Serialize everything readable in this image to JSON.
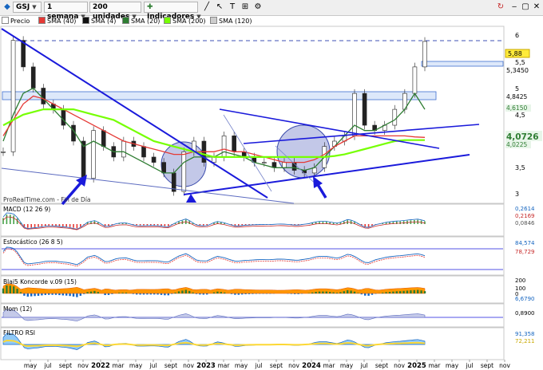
{
  "toolbar": {
    "symbol": "GSJ",
    "timeframe": "1 semana",
    "units": "200 unidades",
    "indicators_label": "Indicadores"
  },
  "price_legend": [
    {
      "label": "Precio",
      "color": "#ffffff"
    },
    {
      "label": "SMA (40)",
      "color": "#e53935"
    },
    {
      "label": "SMA (4)",
      "color": "#111111"
    },
    {
      "label": "SMA (20)",
      "color": "#2e7d32"
    },
    {
      "label": "SMA (200)",
      "color": "#76ff03"
    },
    {
      "label": "SMA (120)",
      "color": "#cccccc"
    }
  ],
  "price_axis": {
    "ticks": [
      "6",
      "5,5",
      "5",
      "4,5",
      "4",
      "3,5",
      "3"
    ],
    "labels": [
      {
        "text": "5,88",
        "style": "yellow"
      },
      {
        "text": "5,3450",
        "style": "plain"
      },
      {
        "text": "4,8425",
        "style": "plain"
      },
      {
        "text": "4,6150",
        "style": "green"
      },
      {
        "text": "4,0726",
        "style": "green-bold"
      },
      {
        "text": "4,0225",
        "style": "green"
      }
    ]
  },
  "watermark": "ProRealTime.com - Fin de Día",
  "panels": [
    {
      "key": "macd",
      "title": "MACD (12 26 9)",
      "values": [
        "0,2614",
        "0,2169",
        "0,0846"
      ]
    },
    {
      "key": "stoch",
      "title": "Estocástico (26 8 5)",
      "values": [
        "84,574",
        "78,729"
      ]
    },
    {
      "key": "konc",
      "title": "Blai5 Koncorde v.09 (15)",
      "values": [
        "200",
        "100",
        "0",
        "6,6790"
      ]
    },
    {
      "key": "mom",
      "title": "Mom (12)",
      "values": [
        "0,8900"
      ]
    },
    {
      "key": "rsi",
      "title": "FILTRO RSI",
      "values": [
        "91,358",
        "72,211"
      ]
    }
  ],
  "x_axis": [
    "may",
    "jul",
    "sept",
    "nov",
    "2022",
    "mar",
    "may",
    "jul",
    "sept",
    "nov",
    "2023",
    "mar",
    "may",
    "jul",
    "sept",
    "nov",
    "2024",
    "mar",
    "may",
    "jul",
    "sept",
    "nov",
    "2025",
    "mar",
    "may",
    "jul",
    "sept",
    "nov"
  ],
  "chart_data": {
    "type": "line",
    "title": "GSJ",
    "ylim": [
      2.9,
      6.2
    ],
    "x": [
      "2021-03",
      "2021-04",
      "2021-05",
      "2021-06",
      "2021-07",
      "2021-08",
      "2021-09",
      "2021-10",
      "2021-11",
      "2021-12",
      "2022-01",
      "2022-02",
      "2022-03",
      "2022-04",
      "2022-05",
      "2022-06",
      "2022-07",
      "2022-08",
      "2022-09",
      "2022-10",
      "2022-11",
      "2022-12",
      "2023-01",
      "2023-02",
      "2023-03",
      "2023-04",
      "2023-05",
      "2023-06",
      "2023-07",
      "2023-08",
      "2023-09",
      "2023-10",
      "2023-11",
      "2023-12",
      "2024-01",
      "2024-02",
      "2024-03",
      "2024-04",
      "2024-05",
      "2024-06",
      "2024-07",
      "2024-08",
      "2024-09",
      "2024-10",
      "2024-11",
      "2024-12",
      "2025-01"
    ],
    "series": [
      {
        "name": "Precio",
        "values": [
          3.8,
          5.9,
          5.4,
          5.0,
          4.7,
          4.6,
          4.3,
          4.0,
          3.3,
          4.2,
          3.9,
          3.7,
          4.0,
          3.9,
          3.7,
          3.6,
          3.4,
          3.05,
          3.8,
          4.0,
          3.6,
          3.7,
          4.1,
          3.8,
          3.7,
          3.6,
          3.6,
          3.5,
          3.6,
          3.45,
          3.4,
          3.5,
          3.9,
          4.0,
          4.1,
          4.9,
          4.3,
          4.2,
          4.3,
          4.6,
          4.9,
          5.4,
          5.88
        ]
      },
      {
        "name": "SMA (20)",
        "values": [
          4.0,
          4.5,
          4.9,
          5.0,
          4.8,
          4.6,
          4.4,
          4.2,
          3.9,
          4.0,
          3.9,
          3.8,
          3.8,
          3.7,
          3.6,
          3.5,
          3.4,
          3.4,
          3.6,
          3.7,
          3.7,
          3.7,
          3.8,
          3.75,
          3.7,
          3.6,
          3.55,
          3.5,
          3.5,
          3.5,
          3.45,
          3.5,
          3.7,
          3.9,
          4.1,
          4.3,
          4.2,
          4.2,
          4.3,
          4.4,
          4.6,
          4.9,
          4.6
        ]
      },
      {
        "name": "SMA (40)",
        "values": [
          4.1,
          4.4,
          4.7,
          4.85,
          4.8,
          4.7,
          4.6,
          4.5,
          4.4,
          4.3,
          4.2,
          4.1,
          4.0,
          3.95,
          3.9,
          3.85,
          3.8,
          3.75,
          3.75,
          3.8,
          3.8,
          3.8,
          3.85,
          3.8,
          3.8,
          3.75,
          3.7,
          3.65,
          3.6,
          3.6,
          3.6,
          3.65,
          3.75,
          3.9,
          4.0,
          4.1,
          4.1,
          4.1,
          4.1,
          4.1,
          4.1,
          4.08,
          4.07
        ]
      },
      {
        "name": "SMA (200)",
        "values": [
          4.3,
          4.4,
          4.5,
          4.55,
          4.6,
          4.6,
          4.6,
          4.6,
          4.55,
          4.5,
          4.45,
          4.4,
          4.3,
          4.2,
          4.1,
          4.0,
          3.95,
          3.9,
          3.85,
          3.8,
          3.75,
          3.7,
          3.7,
          3.7,
          3.7,
          3.7,
          3.7,
          3.7,
          3.7,
          3.7,
          3.7,
          3.7,
          3.7,
          3.72,
          3.75,
          3.8,
          3.85,
          3.9,
          3.95,
          4.0,
          4.02,
          4.02,
          4.02
        ]
      }
    ]
  }
}
